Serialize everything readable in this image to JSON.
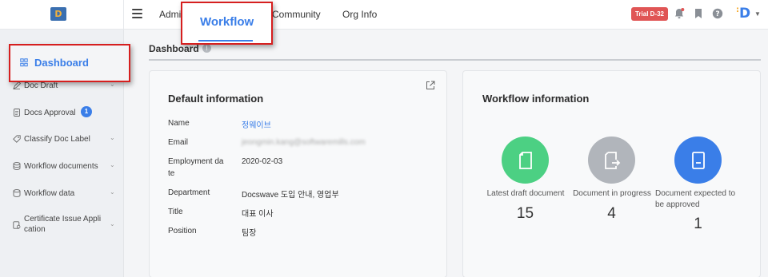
{
  "app": {
    "logo_letter": "D",
    "brand_letter": "D",
    "trial_badge": "Trial D-32"
  },
  "nav": {
    "items": [
      {
        "label": "Admin"
      },
      {
        "label": "Workflow"
      },
      {
        "label": "Community"
      },
      {
        "label": "Org Info"
      }
    ]
  },
  "sidebar": {
    "items": [
      {
        "label": "Dashboard",
        "icon": "dashboard-icon"
      },
      {
        "label": "Doc Draft",
        "icon": "pen-icon"
      },
      {
        "label": "Docs Approval",
        "icon": "document-icon",
        "badge": "1"
      },
      {
        "label": "Classify Doc Label",
        "icon": "tag-icon"
      },
      {
        "label": "Workflow documents",
        "icon": "stack-icon"
      },
      {
        "label": "Workflow data",
        "icon": "database-icon"
      },
      {
        "label": "Certificate Issue Application",
        "label_line1": "Certificate Issue Appli",
        "label_line2": "cation",
        "icon": "certificate-icon"
      }
    ]
  },
  "page": {
    "title": "Dashboard"
  },
  "default_info": {
    "title": "Default information",
    "rows": [
      {
        "label": "Name",
        "value": "정웨이브"
      },
      {
        "label": "Email",
        "value": "jeongmin.kang@softwaremills.com"
      },
      {
        "label": "Employment date",
        "label_line1": "Employment da",
        "label_line2": "te",
        "value": "2020-02-03"
      },
      {
        "label": "Department",
        "value": "Docswave 도입 안내, 영업부"
      },
      {
        "label": "Title",
        "value": "대표 이사"
      },
      {
        "label": "Position",
        "value": "팀장"
      }
    ]
  },
  "workflow_info": {
    "title": "Workflow information",
    "stats": [
      {
        "label": "Latest draft document",
        "count": "15",
        "color": "#4cd083"
      },
      {
        "label": "Document in progress",
        "count": "4",
        "color": "#b1b5bb"
      },
      {
        "label": "Document expected to be approved",
        "label_line1": "Document expected to",
        "label_line2": "be approved",
        "count": "1",
        "color": "#3a7ee8"
      }
    ]
  },
  "colors": {
    "accent": "#3a7ee8",
    "trial": "#e05555",
    "highlight_border": "#d61f1f"
  }
}
